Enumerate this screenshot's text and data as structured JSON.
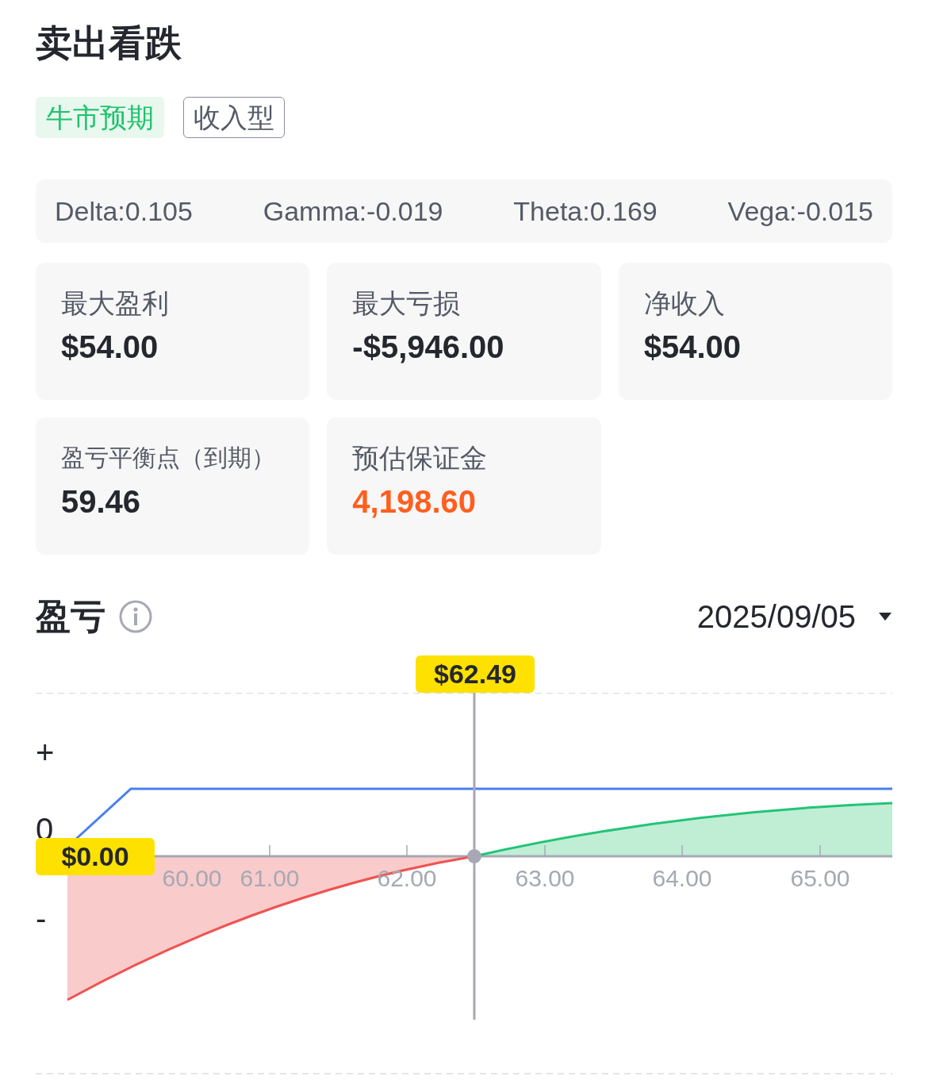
{
  "title": "卖出看跌",
  "tags": [
    {
      "label": "牛市预期",
      "kind": "filled"
    },
    {
      "label": "收入型",
      "kind": "outline"
    }
  ],
  "greeks": [
    "Delta:0.105",
    "Gamma:-0.019",
    "Theta:0.169",
    "Vega:-0.015"
  ],
  "stats": [
    {
      "label": "最大盈利",
      "value": "$54.00",
      "kind": "plain"
    },
    {
      "label": "最大亏损",
      "value": "-$5,946.00",
      "kind": "plain"
    },
    {
      "label": "净收入",
      "value": "$54.00",
      "kind": "plain"
    },
    {
      "label": "盈亏平衡点（到期）",
      "value": "59.46",
      "kind": "plain"
    },
    {
      "label": "预估保证金",
      "value": "4,198.60",
      "kind": "highlight"
    }
  ],
  "pnl": {
    "title": "盈亏",
    "date": "2025/09/05",
    "y_labels": [
      "+",
      "0",
      "-"
    ],
    "x_ticks": [
      "60.00",
      "61.00",
      "62.00",
      "63.00",
      "64.00",
      "65.00"
    ],
    "cursor_price": "$62.49",
    "cursor_value": "$0.00"
  }
}
